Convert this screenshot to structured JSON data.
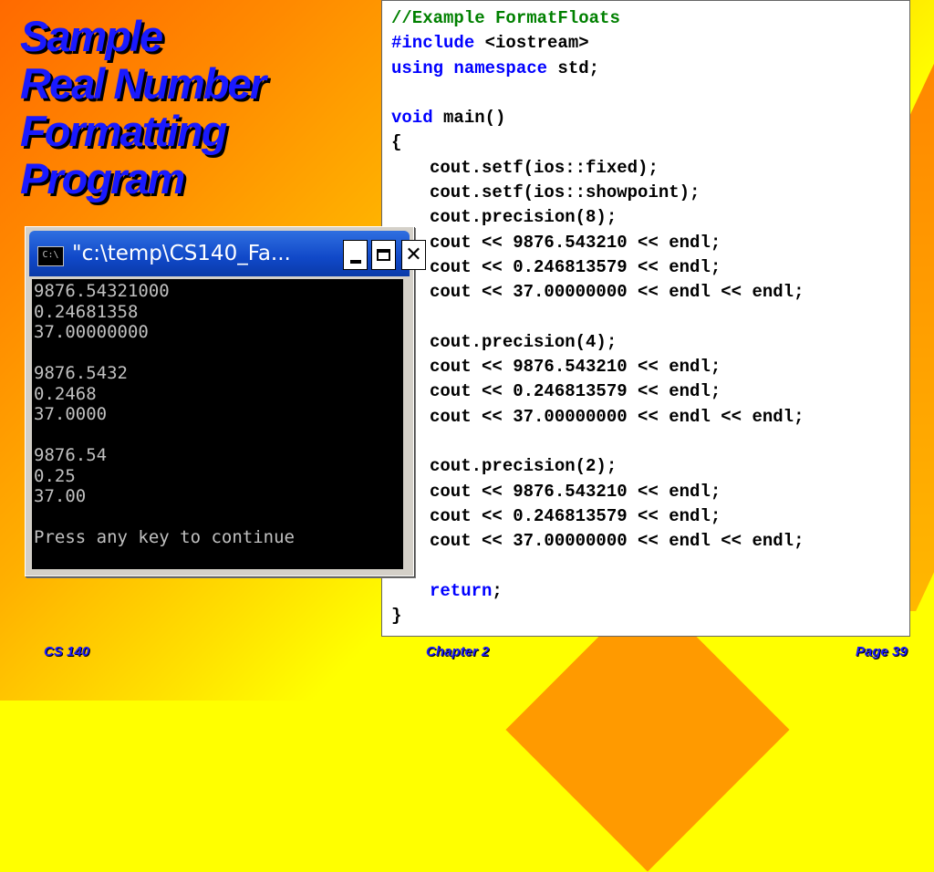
{
  "slide": {
    "title_lines": [
      "Sample",
      "Real Number",
      "Formatting",
      "Program"
    ]
  },
  "code": {
    "lines": [
      {
        "text": "//Example FormatFloats",
        "style": "comment"
      },
      {
        "parts": [
          {
            "text": "#include",
            "style": "kw"
          },
          {
            "text": " <iostream>",
            "style": ""
          }
        ]
      },
      {
        "parts": [
          {
            "text": "using namespace",
            "style": "kw"
          },
          {
            "text": " std;",
            "style": ""
          }
        ]
      },
      {
        "text": "",
        "style": ""
      },
      {
        "parts": [
          {
            "text": "void",
            "style": "kw"
          },
          {
            "text": " main()",
            "style": ""
          }
        ]
      },
      {
        "text": "{",
        "style": ""
      },
      {
        "text": "cout.setf(ios::fixed);",
        "indent": true
      },
      {
        "text": "cout.setf(ios::showpoint);",
        "indent": true
      },
      {
        "text": "cout.precision(8);",
        "indent": true
      },
      {
        "text": "cout << 9876.543210 << endl;",
        "indent": true
      },
      {
        "text": "cout << 0.246813579 << endl;",
        "indent": true
      },
      {
        "text": "cout << 37.00000000 << endl << endl;",
        "indent": true
      },
      {
        "text": "",
        "style": ""
      },
      {
        "text": "cout.precision(4);",
        "indent": true
      },
      {
        "text": "cout << 9876.543210 << endl;",
        "indent": true
      },
      {
        "text": "cout << 0.246813579 << endl;",
        "indent": true
      },
      {
        "text": "cout << 37.00000000 << endl << endl;",
        "indent": true
      },
      {
        "text": "",
        "style": ""
      },
      {
        "text": "cout.precision(2);",
        "indent": true
      },
      {
        "text": "cout << 9876.543210 << endl;",
        "indent": true
      },
      {
        "text": "cout << 0.246813579 << endl;",
        "indent": true
      },
      {
        "text": "cout << 37.00000000 << endl << endl;",
        "indent": true
      },
      {
        "text": "",
        "style": ""
      },
      {
        "parts": [
          {
            "text": "return",
            "style": "kw"
          },
          {
            "text": ";",
            "style": ""
          }
        ],
        "indent": true
      },
      {
        "text": "}",
        "style": ""
      }
    ]
  },
  "console": {
    "icon_label": "C:\\",
    "title": "\"c:\\temp\\CS140_Fa...",
    "output_lines": [
      "9876.54321000",
      "0.24681358",
      "37.00000000",
      "",
      "9876.5432",
      "0.2468",
      "37.0000",
      "",
      "9876.54",
      "0.25",
      "37.00",
      "",
      "Press any key to continue"
    ]
  },
  "footer": {
    "left": "CS 140",
    "center": "Chapter 2",
    "right": "Page 39"
  },
  "colors": {
    "title": "#1a1aff",
    "comment": "#008000",
    "keyword": "#0000ff",
    "titlebar": "#1048c8"
  }
}
